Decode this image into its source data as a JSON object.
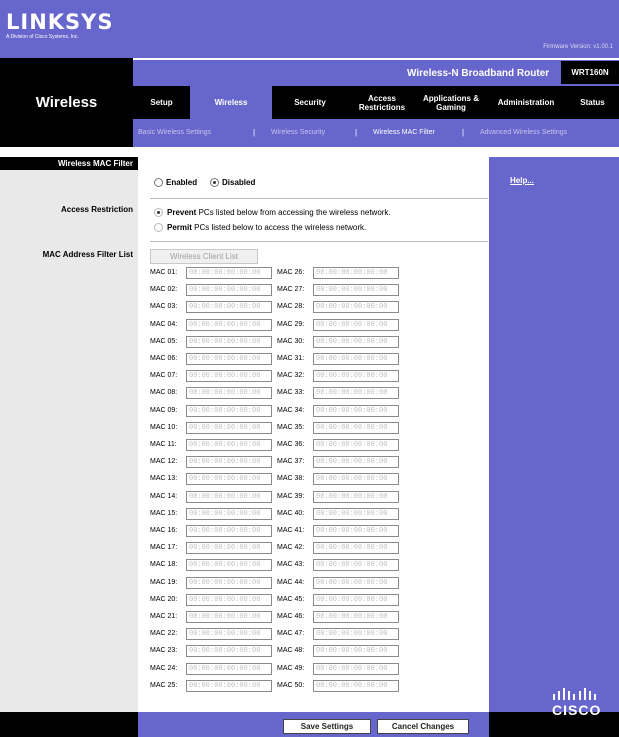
{
  "brand": {
    "logo": "LINKSYS",
    "logo_sub": "A Division of Cisco Systems, Inc.",
    "firmware": "Firmware Version: v1.00.1",
    "product": "Wireless-N Broadband Router",
    "model": "WRT160N",
    "cisco": "CISCO"
  },
  "section_title": "Wireless",
  "tabs": [
    {
      "label": "Setup"
    },
    {
      "label": "Wireless"
    },
    {
      "label": "Security"
    },
    {
      "label": "Access Restrictions"
    },
    {
      "label": "Applications & Gaming"
    },
    {
      "label": "Administration"
    },
    {
      "label": "Status"
    }
  ],
  "active_tab": "Wireless",
  "subnav": [
    {
      "label": "Basic Wireless Settings"
    },
    {
      "label": "Wireless Security"
    },
    {
      "label": "Wireless MAC Filter"
    },
    {
      "label": "Advanced Wireless Settings"
    }
  ],
  "active_subnav": "Wireless MAC Filter",
  "labels": {
    "mac_filter": "Wireless MAC Filter",
    "access_restriction": "Access Restriction",
    "mac_list": "MAC Address Filter List"
  },
  "filter": {
    "enabled_label": "Enabled",
    "disabled_label": "Disabled",
    "selected": "Disabled"
  },
  "restriction": {
    "prevent_bold": "Prevent",
    "prevent_rest": " PCs listed below from accessing the wireless network.",
    "permit_bold": "Permit",
    "permit_rest": " PCs listed below to access the wireless network.",
    "selected": "Prevent"
  },
  "client_list_button": "Wireless Client List",
  "mac_entries": [
    {
      "label": "MAC 01:",
      "value": "00:00:00:00:00:00"
    },
    {
      "label": "MAC 02:",
      "value": "00:00:00:00:00:00"
    },
    {
      "label": "MAC 03:",
      "value": "00:00:00:00:00:00"
    },
    {
      "label": "MAC 04:",
      "value": "00:00:00:00:00:00"
    },
    {
      "label": "MAC 05:",
      "value": "00:00:00:00:00:00"
    },
    {
      "label": "MAC 06:",
      "value": "00:00:00:00:00:00"
    },
    {
      "label": "MAC 07:",
      "value": "00:00:00:00:00:00"
    },
    {
      "label": "MAC 08:",
      "value": "00:00:00:00:00:00"
    },
    {
      "label": "MAC 09:",
      "value": "00:00:00:00:00:00"
    },
    {
      "label": "MAC 10:",
      "value": "00:00:00:00:00:00"
    },
    {
      "label": "MAC 11:",
      "value": "00:00:00:00:00:00"
    },
    {
      "label": "MAC 12:",
      "value": "00:00:00:00:00:00"
    },
    {
      "label": "MAC 13:",
      "value": "00:00:00:00:00:00"
    },
    {
      "label": "MAC 14:",
      "value": "00:00:00:00:00:00"
    },
    {
      "label": "MAC 15:",
      "value": "00:00:00:00:00:00"
    },
    {
      "label": "MAC 16:",
      "value": "00:00:00:00:00:00"
    },
    {
      "label": "MAC 17:",
      "value": "00:00:00:00:00:00"
    },
    {
      "label": "MAC 18:",
      "value": "00:00:00:00:00:00"
    },
    {
      "label": "MAC 19:",
      "value": "00:00:00:00:00:00"
    },
    {
      "label": "MAC 20:",
      "value": "00:00:00:00:00:00"
    },
    {
      "label": "MAC 21:",
      "value": "00:00:00:00:00:00"
    },
    {
      "label": "MAC 22:",
      "value": "00:00:00:00:00:00"
    },
    {
      "label": "MAC 23:",
      "value": "00:00:00:00:00:00"
    },
    {
      "label": "MAC 24:",
      "value": "00:00:00:00:00:00"
    },
    {
      "label": "MAC 25:",
      "value": "00:00:00:00:00:00"
    },
    {
      "label": "MAC 26:",
      "value": "00:00:00:00:00:00"
    },
    {
      "label": "MAC 27:",
      "value": "00:00:00:00:00:00"
    },
    {
      "label": "MAC 28:",
      "value": "00:00:00:00:00:00"
    },
    {
      "label": "MAC 29:",
      "value": "00:00:00:00:00:00"
    },
    {
      "label": "MAC 30:",
      "value": "00:00:00:00:00:00"
    },
    {
      "label": "MAC 31:",
      "value": "00:00:00:00:00:00"
    },
    {
      "label": "MAC 32:",
      "value": "00:00:00:00:00:00"
    },
    {
      "label": "MAC 33:",
      "value": "00:00:00:00:00:00"
    },
    {
      "label": "MAC 34:",
      "value": "00:00:00:00:00:00"
    },
    {
      "label": "MAC 35:",
      "value": "00:00:00:00:00:00"
    },
    {
      "label": "MAC 36:",
      "value": "00:00:00:00:00:00"
    },
    {
      "label": "MAC 37:",
      "value": "00:00:00:00:00:00"
    },
    {
      "label": "MAC 38:",
      "value": "00:00:00:00:00:00"
    },
    {
      "label": "MAC 39:",
      "value": "00:00:00:00:00:00"
    },
    {
      "label": "MAC 40:",
      "value": "00:00:00:00:00:00"
    },
    {
      "label": "MAC 41:",
      "value": "00:00:00:00:00:00"
    },
    {
      "label": "MAC 42:",
      "value": "00:00:00:00:00:00"
    },
    {
      "label": "MAC 43:",
      "value": "00:00:00:00:00:00"
    },
    {
      "label": "MAC 44:",
      "value": "00:00:00:00:00:00"
    },
    {
      "label": "MAC 45:",
      "value": "00:00:00:00:00:00"
    },
    {
      "label": "MAC 46:",
      "value": "00:00:00:00:00:00"
    },
    {
      "label": "MAC 47:",
      "value": "00:00:00:00:00:00"
    },
    {
      "label": "MAC 48:",
      "value": "00:00:00:00:00:00"
    },
    {
      "label": "MAC 49:",
      "value": "00:00:00:00:00:00"
    },
    {
      "label": "MAC 50:",
      "value": "00:00:00:00:00:00"
    }
  ],
  "help_link": "Help...",
  "buttons": {
    "save": "Save Settings",
    "cancel": "Cancel Changes"
  },
  "colors": {
    "brand_purple": "#6666cc",
    "black": "#000000",
    "label_gray": "#e9e9e9"
  }
}
